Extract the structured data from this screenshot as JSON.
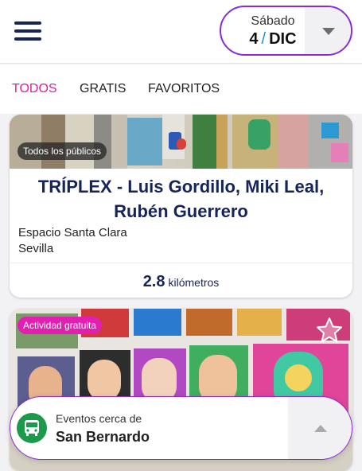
{
  "header": {
    "date_day": "Sábado",
    "date_num": "4",
    "date_sep": "/",
    "date_month": "DIC",
    "menu_icon": "hamburger-menu-icon",
    "dropdown_icon": "chevron-down-icon"
  },
  "tabs": [
    {
      "label": "TODOS",
      "active": true
    },
    {
      "label": "GRATIS",
      "active": false
    },
    {
      "label": "FAVORITOS",
      "active": false
    }
  ],
  "events": [
    {
      "badge": "Todos los públicos",
      "title": "TRÍPLEX - Luis Gordillo, Miki Leal, Rubén Guerrero",
      "venue": "Espacio Santa Clara",
      "city": "Sevilla",
      "distance_value": "2.8",
      "distance_unit": "kilómetros"
    },
    {
      "badge": "Actividad gratuita",
      "favorite_icon": "star-icon"
    }
  ],
  "location_bar": {
    "caption": "Eventos cerca de",
    "value": "San Bernardo",
    "icon": "bus-icon",
    "toggle_icon": "chevron-up-icon"
  },
  "colors": {
    "accent_magenta": "#d81fa7",
    "border_purple": "#8a2bd6",
    "navy": "#152459",
    "bus_green": "#1c9a4b"
  }
}
